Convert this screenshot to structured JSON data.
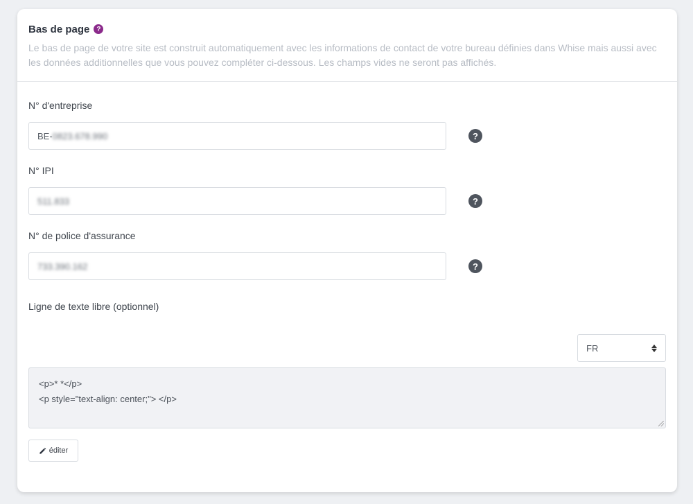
{
  "section": {
    "title": "Bas de page",
    "help_icon": "question-circle-icon",
    "description": "Le bas de page de votre site est construit automatiquement avec les informations de contact de votre bureau définies dans Whise mais aussi avec les données additionnelles que vous pouvez compléter ci-dessous. Les champs vides ne seront pas affichés."
  },
  "fields": [
    {
      "label": "N° d'entreprise",
      "prefix": "BE-",
      "value": "0823.678.990",
      "help_icon": "question-circle-icon"
    },
    {
      "label": "N° IPI",
      "value": "511.833",
      "help_icon": "question-circle-icon"
    },
    {
      "label": "N° de police d'assurance",
      "value": "733.390.162",
      "help_icon": "question-circle-icon"
    }
  ],
  "free_text": {
    "label": "Ligne de texte libre (optionnel)",
    "language": "FR",
    "line1": "<p>* *</p>",
    "line2": "<p style=\"text-align: center;\"> </p>",
    "edit_label": "éditer",
    "edit_icon": "pencil-icon"
  },
  "colors": {
    "accent": "#8b2a8b",
    "help_icon": "#4f555e",
    "background": "#eef0f3"
  }
}
